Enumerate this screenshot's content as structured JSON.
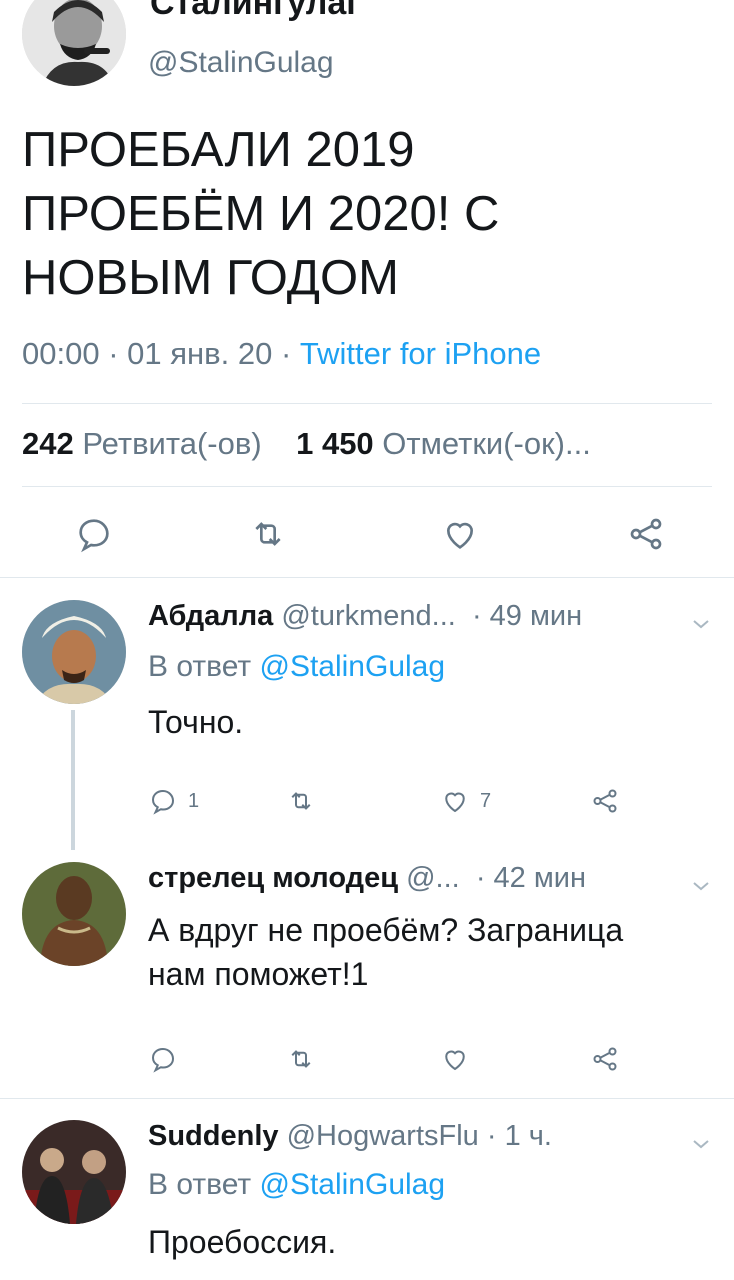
{
  "tweet": {
    "author_name": "Сталингулаг",
    "author_handle": "@StalinGulag",
    "text_lines": [
      "ПРОЕБАЛИ 2019",
      "ПРОЕБЁМ И 2020! С",
      "НОВЫМ ГОДОМ"
    ],
    "time": "00:00",
    "date": "01 янв. 20",
    "source": "Twitter for iPhone",
    "sep": "·",
    "retweets_count": "242",
    "retweets_label": "Ретвита(-ов)",
    "likes_count": "1 450",
    "likes_label": "Отметки(-ок)..."
  },
  "icons": {
    "reply": "reply-icon",
    "retweet": "retweet-icon",
    "like": "heart-icon",
    "share": "share-icon",
    "more": "chevron-down-icon"
  },
  "replies": [
    {
      "name": "Абдалла",
      "handle": "@turkmend...",
      "time": "· 49 мин",
      "reply_to_prefix": "В ответ",
      "reply_to_handle": "@StalinGulag",
      "text": "Точно.",
      "reply_count": "1",
      "like_count": "7"
    },
    {
      "name": "стрелец молодец",
      "handle": "@...",
      "time": "· 42 мин",
      "text_lines": [
        "А вдруг не проебём? Заграница",
        "нам поможет!1"
      ]
    },
    {
      "name": "Suddenly",
      "handle": "@HogwartsFlu",
      "time": "· 1 ч.",
      "reply_to_prefix": "В ответ",
      "reply_to_handle": "@StalinGulag",
      "text": "Проебоссия."
    }
  ],
  "colors": {
    "link": "#1da1f2",
    "secondary_text": "#657786",
    "divider": "#e1e8ed"
  }
}
